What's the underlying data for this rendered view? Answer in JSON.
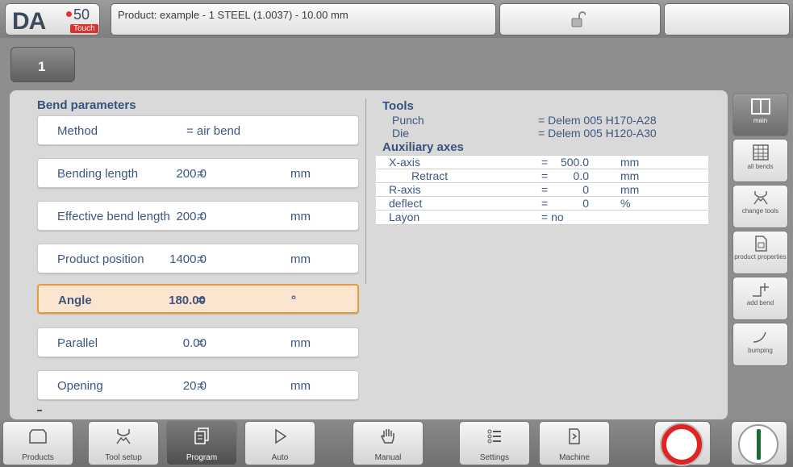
{
  "header": {
    "logo_text": "DA",
    "logo_model": "50",
    "logo_sub": "Touch",
    "product_text": "Product: example - 1 STEEL (1.0037) - 10.00 mm"
  },
  "tab": {
    "label": "1"
  },
  "bend_parameters": {
    "title": "Bend parameters",
    "rows": [
      {
        "label": "Method",
        "eq": "= air bend",
        "value": "",
        "unit": ""
      },
      {
        "label": "Bending length",
        "eq": "=",
        "value": "200.0",
        "unit": "mm"
      },
      {
        "label": "Effective bend length",
        "eq": "=",
        "value": "200.0",
        "unit": "mm"
      },
      {
        "label": "Product position",
        "eq": "=",
        "value": "1400.0",
        "unit": "mm"
      },
      {
        "label": "Angle",
        "eq": "=",
        "value": "180.00",
        "unit": "°"
      },
      {
        "label": "Parallel",
        "eq": "=",
        "value": "0.00",
        "unit": "mm"
      },
      {
        "label": "Opening",
        "eq": "=",
        "value": "20.0",
        "unit": "mm"
      }
    ]
  },
  "tools": {
    "title": "Tools",
    "punch_label": "Punch",
    "punch_value": "=  Delem 005 H170-A28",
    "die_label": "Die",
    "die_value": "=  Delem 005 H120-A30"
  },
  "auxiliary_axes": {
    "title": "Auxiliary axes",
    "rows": [
      {
        "label": "X-axis",
        "eq": "=",
        "value": "500.0",
        "unit": "mm"
      },
      {
        "label": "Retract",
        "eq": "=",
        "value": "0.0",
        "unit": "mm"
      },
      {
        "label": "R-axis",
        "eq": "=",
        "value": "0",
        "unit": "mm"
      },
      {
        "label": "deflect",
        "eq": "=",
        "value": "0",
        "unit": "%"
      },
      {
        "label": "Layon",
        "eq": "= no",
        "value": "",
        "unit": ""
      }
    ]
  },
  "sidebar": {
    "main": "main",
    "all_bends": "all bends",
    "change_tools": "change tools",
    "product_properties": "product properties",
    "add_bend": "add bend",
    "bumping": "bumping"
  },
  "bottom_nav": {
    "products": "Products",
    "tool_setup": "Tool setup",
    "program": "Program",
    "auto": "Auto",
    "manual": "Manual",
    "settings": "Settings",
    "machine": "Machine"
  },
  "colors": {
    "accent_text": "#3d5680",
    "selected_bg": "#fce5cf",
    "selected_border": "#e89a3d",
    "stop_red": "#e02424",
    "start_green": "#1a6b32"
  }
}
